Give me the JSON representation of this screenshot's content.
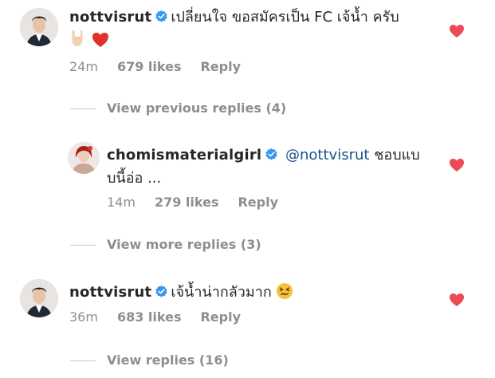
{
  "comments": [
    {
      "username": "nottvisrut",
      "text": "เปลี่ยนใจ ขอสมัครเป็น FC เจ้น้ำ ครับ",
      "emoji_1": "rock-hand-emoji",
      "emoji_2": "red-heart-emoji",
      "time": "24m",
      "likes": "679 likes",
      "reply": "Reply"
    },
    {
      "username": "chomismaterialgirl",
      "mention": "@nottvisrut",
      "text_line1": "ชอบแบ",
      "text_line2": "บนี้อ่อ ...",
      "time": "14m",
      "likes": "279 likes",
      "reply": "Reply"
    },
    {
      "username": "nottvisrut",
      "text": "เจ้น้ำน่ากลัวมาก",
      "emoji_1": "persevering-face-emoji",
      "time": "36m",
      "likes": "683 likes",
      "reply": "Reply"
    }
  ],
  "threads": {
    "previous_replies": "View previous replies (4)",
    "more_replies": "View more replies (3)",
    "view_replies": "View replies (16)"
  },
  "colors": {
    "heart": "#ed4956",
    "verified": "#3897f0",
    "muted": "#8e8e8e",
    "mention": "#1c4f8f"
  }
}
